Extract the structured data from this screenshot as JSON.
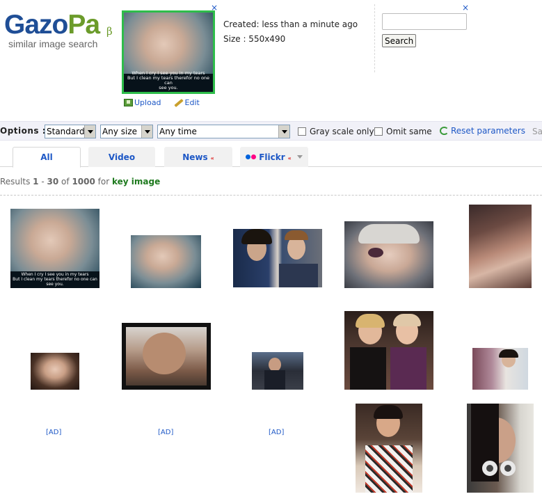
{
  "logo": {
    "word_part1": "Gazo",
    "word_part2": "Pa",
    "beta": "β",
    "tagline": "similar image search"
  },
  "key_image": {
    "caption_lines": [
      "When I cry I see you in my tears",
      "But I clean my tears therefor no one can",
      "see you."
    ],
    "upload_label": "Upload",
    "edit_label": "Edit",
    "created": "Created: less than a minute ago",
    "size": "Size : 550x490"
  },
  "close_glyph": "×",
  "search": {
    "button_label": "Search",
    "value": ""
  },
  "options": {
    "label": "Options :",
    "style": "Standard",
    "size": "Any size",
    "time": "Any time",
    "grayscale_label": "Gray scale only",
    "omit_label": "Omit same",
    "reset_label": "Reset parameters",
    "trailing": "Sa"
  },
  "tabs": {
    "all": "All",
    "video": "Video",
    "news": "News",
    "flickr": "Flickr",
    "new_badge": "«"
  },
  "results": {
    "prefix": "Results",
    "from": "1",
    "to": "30",
    "of": "of",
    "total": "1000",
    "for": "for",
    "query": "key image"
  },
  "images": {
    "r1c1_caption": [
      "When I cry I see you in my tears",
      "But I clean my tears therefor no one can",
      "see you."
    ],
    "ad_label": "[AD]"
  },
  "colors": {
    "brand_blue": "#1f4e96",
    "brand_green": "#6b9b2a",
    "link": "#1e58c6",
    "highlight": "#2ebd4a",
    "flickr_blue": "#0063dc",
    "flickr_pink": "#ff0084"
  }
}
